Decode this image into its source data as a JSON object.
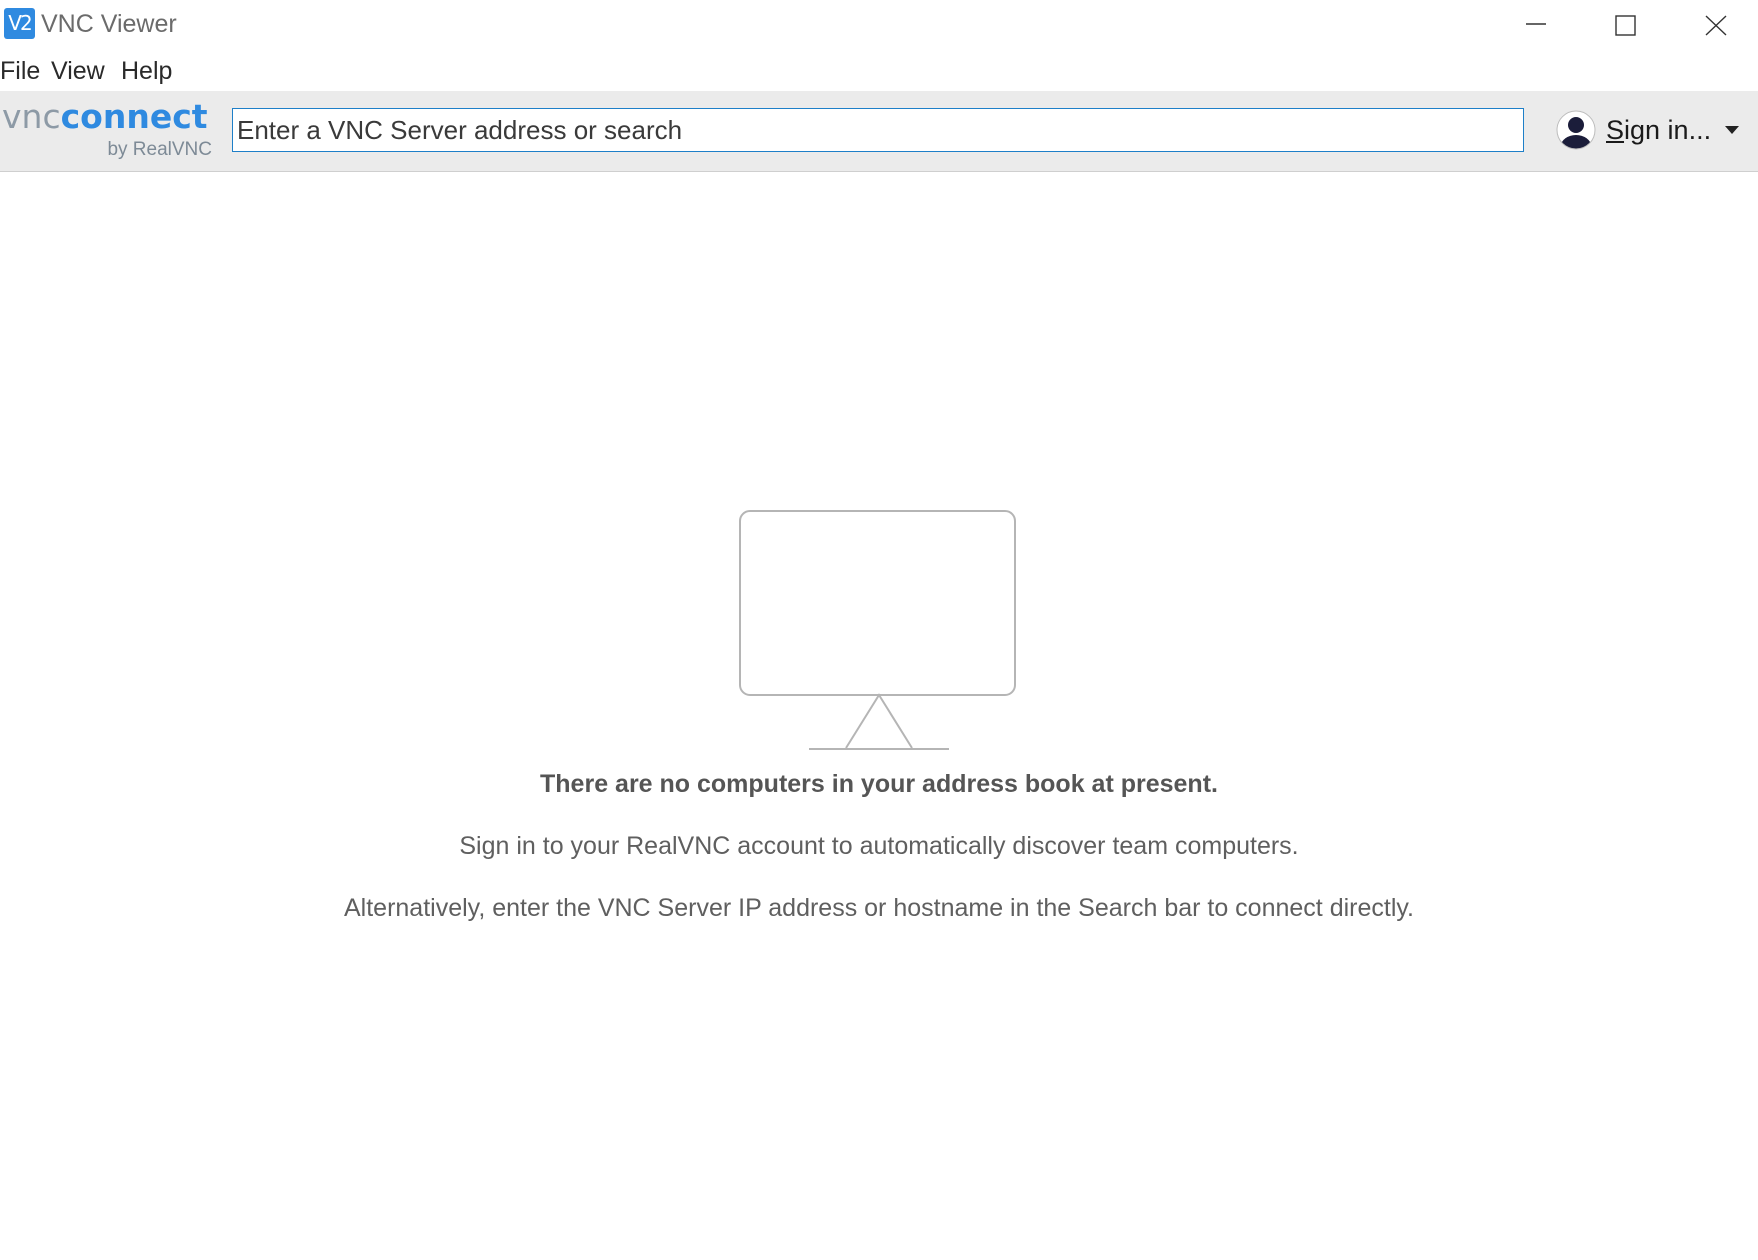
{
  "window": {
    "title": "VNC Viewer",
    "icon_text": "V2",
    "controls": [
      "minimize-icon",
      "maximize-icon",
      "close-icon"
    ]
  },
  "menu": {
    "file": "File",
    "view": "View",
    "help": "Help"
  },
  "toolbar": {
    "logo_vnc": "vnc",
    "logo_connect": "connect",
    "logo_sub": "by RealVNC",
    "search_placeholder": "Enter a VNC Server address or search",
    "search_value": "",
    "signin_label": "Sign in...",
    "avatar_icon": "user-avatar-icon",
    "dropdown_icon": "caret-down-icon"
  },
  "empty_state": {
    "icon": "monitor-icon",
    "title": "There are no computers in your address book at present.",
    "line1": "Sign in to your RealVNC account to automatically discover team computers.",
    "line2": "Alternatively, enter the VNC Server IP address or hostname in the Search bar to connect directly."
  },
  "colors": {
    "accent": "#2f8ae0",
    "toolbar_bg": "#ebebeb",
    "search_border": "#1e7fc8",
    "text_muted": "#5f5f5f"
  }
}
